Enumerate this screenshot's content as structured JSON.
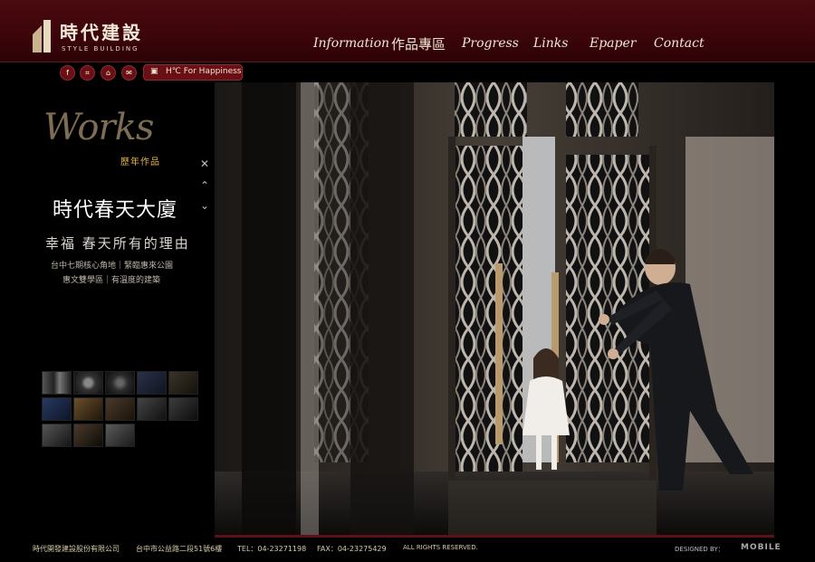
{
  "header": {
    "logo_zh": "時代建設",
    "logo_en": "STYLE BUILDING",
    "nav": [
      "Information",
      "作品專區",
      "Progress",
      "Links",
      "Epaper",
      "Contact"
    ]
  },
  "toolbar": {
    "icons": [
      "facebook-icon",
      "sitemap-icon",
      "home-icon",
      "mail-icon"
    ],
    "slogan": "H℃ For Happiness"
  },
  "works": {
    "title": "Works",
    "subtitle": "歷年作品",
    "project_name": "時代春天大廈",
    "tagline": "幸福 春天所有的理由",
    "desc_line1": "台中七期核心角地｜緊臨惠來公園",
    "desc_line2": "惠文雙學區｜有溫度的建築"
  },
  "footer": {
    "company": "時代開發建設股份有限公司",
    "address": "台中市公益路二段51號6樓",
    "tel": "TEL：04-23271198",
    "fax": "FAX：04-23275429",
    "rights": "ALL RIGHTS RESERVED.",
    "designed_by": "DESIGNED BY：",
    "designer": "MOBILE"
  },
  "colors": {
    "header_bg": "#3b0509",
    "accent_gold": "#e7b64a",
    "pill_bg": "#6a1015"
  }
}
